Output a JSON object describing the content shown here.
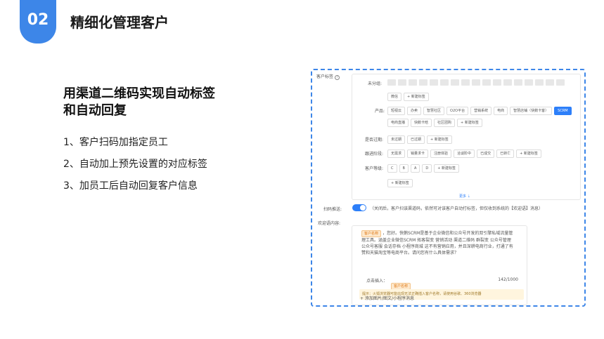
{
  "header": {
    "badge": "02",
    "title": "精细化管理客户"
  },
  "subtitle": {
    "line1": "用渠道二维码实现自动标签",
    "line2": "和自动回复"
  },
  "steps": [
    "1、客户扫码加指定员工",
    "2、自动加上预先设置的对应标签",
    "3、加员工后自动回复客户信息"
  ],
  "panel": {
    "customer_tags_label": "客户标签",
    "help_symbol": "?",
    "ungrouped": {
      "label": "未分组:",
      "chips": [
        "微信"
      ],
      "add": "+ 新建标签"
    },
    "product": {
      "label": "产品:",
      "chips": [
        "短视云",
        "办卖",
        "智慧社区",
        "O2O平台",
        "营销系统",
        "电商",
        "智慧店铺（快鹅卡客）",
        "SCRM"
      ],
      "active": "SCRM",
      "chips2": [
        "电商直播",
        "快鹅卡晗",
        "社区团购"
      ],
      "add": "+ 新建标签"
    },
    "expired": {
      "label": "是否过期:",
      "chips": [
        "未过期",
        "已过期"
      ],
      "add": "+ 新建标签"
    },
    "stage": {
      "label": "跟进阶段:",
      "chips": [
        "无需求",
        "销量求卡",
        "注册体验",
        "洽谈阶中",
        "已成交",
        "已转亡"
      ],
      "add": "+ 新建标签"
    },
    "level": {
      "label": "客户等级:",
      "chips": [
        "C",
        "B",
        "A",
        "D"
      ],
      "add": "+ 新建标签"
    },
    "standalone_add": "+ 新建标签",
    "more": "更多",
    "qrcode_push_label": "扫码推送:",
    "qrcode_push_desc": "（关闭后，客户扫该渠道码，依然可对该客户自动打标签，但仅收到系统的【欢迎语】消息）",
    "welcome_label": "欢迎语内容:",
    "welcome_tag": "客户名称",
    "welcome_text": "，您好。快鹅SCRM是基于企业微信和公众号开发的双引擎私域流量管理工具。涵盖企业微信SCRM 拓客裂变 营销活动 渠道二维码 群裂变 公众号管理 公众号客服 会话存档 小程序商城 这不有营销应用，并且深耕电商行业，打通了有赞和天猫淘宝等电商平台。请问您有什么具体需求？",
    "insert_label": "点击插入：",
    "insert_tag": "客户名称",
    "counter": "142/1000",
    "tip": "提示：火狐浏览器可能出现无法正确插入客户名称，请使用谷歌、360浏览器",
    "add_media": "+ 添加图片/图文/小程序消息"
  },
  "colors": {
    "accent": "#3d86e8",
    "chip_active": "#2d7ff9",
    "tag_orange": "#e07b1a"
  }
}
